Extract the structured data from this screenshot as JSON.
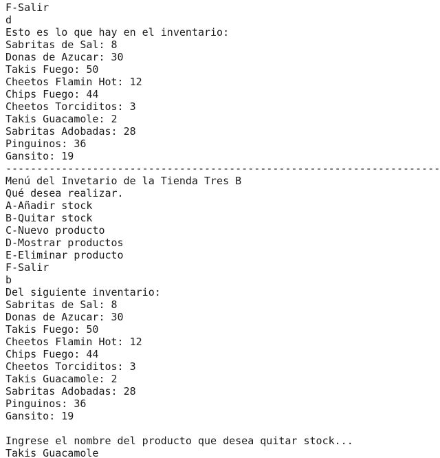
{
  "terminal": {
    "lines": [
      {
        "kind": "menu-option",
        "text": "F-Salir"
      },
      {
        "kind": "user-input",
        "text": "d"
      },
      {
        "kind": "output",
        "text": "Esto es lo que hay en el inventario:"
      },
      {
        "kind": "inventory",
        "text": "Sabritas de Sal: 8"
      },
      {
        "kind": "inventory",
        "text": "Donas de Azucar: 30"
      },
      {
        "kind": "inventory",
        "text": "Takis Fuego: 50"
      },
      {
        "kind": "inventory",
        "text": "Cheetos Flamin Hot: 12"
      },
      {
        "kind": "inventory",
        "text": "Chips Fuego: 44"
      },
      {
        "kind": "inventory",
        "text": "Cheetos Torciditos: 3"
      },
      {
        "kind": "inventory",
        "text": "Takis Guacamole: 2"
      },
      {
        "kind": "inventory",
        "text": "Sabritas Adobadas: 28"
      },
      {
        "kind": "inventory",
        "text": "Pinguinos: 36"
      },
      {
        "kind": "inventory",
        "text": "Gansito: 19"
      },
      {
        "kind": "separator",
        "text": "------------------------------------------------------------------------------------------"
      },
      {
        "kind": "menu-title",
        "text": "Menú del Invetario de la Tienda Tres B"
      },
      {
        "kind": "menu-prompt",
        "text": "Qué desea realizar."
      },
      {
        "kind": "menu-option",
        "text": "A-Añadir stock"
      },
      {
        "kind": "menu-option",
        "text": "B-Quitar stock"
      },
      {
        "kind": "menu-option",
        "text": "C-Nuevo producto"
      },
      {
        "kind": "menu-option",
        "text": "D-Mostrar productos"
      },
      {
        "kind": "menu-option",
        "text": "E-Eliminar producto"
      },
      {
        "kind": "menu-option",
        "text": "F-Salir"
      },
      {
        "kind": "user-input",
        "text": "b"
      },
      {
        "kind": "output",
        "text": "Del siguiente inventario:"
      },
      {
        "kind": "inventory",
        "text": "Sabritas de Sal: 8"
      },
      {
        "kind": "inventory",
        "text": "Donas de Azucar: 30"
      },
      {
        "kind": "inventory",
        "text": "Takis Fuego: 50"
      },
      {
        "kind": "inventory",
        "text": "Cheetos Flamin Hot: 12"
      },
      {
        "kind": "inventory",
        "text": "Chips Fuego: 44"
      },
      {
        "kind": "inventory",
        "text": "Cheetos Torciditos: 3"
      },
      {
        "kind": "inventory",
        "text": "Takis Guacamole: 2"
      },
      {
        "kind": "inventory",
        "text": "Sabritas Adobadas: 28"
      },
      {
        "kind": "inventory",
        "text": "Pinguinos: 36"
      },
      {
        "kind": "inventory",
        "text": "Gansito: 19"
      },
      {
        "kind": "blank",
        "text": ""
      },
      {
        "kind": "prompt",
        "text": "Ingrese el nombre del producto que desea quitar stock..."
      },
      {
        "kind": "user-input",
        "text": "Takis Guacamole"
      }
    ]
  }
}
